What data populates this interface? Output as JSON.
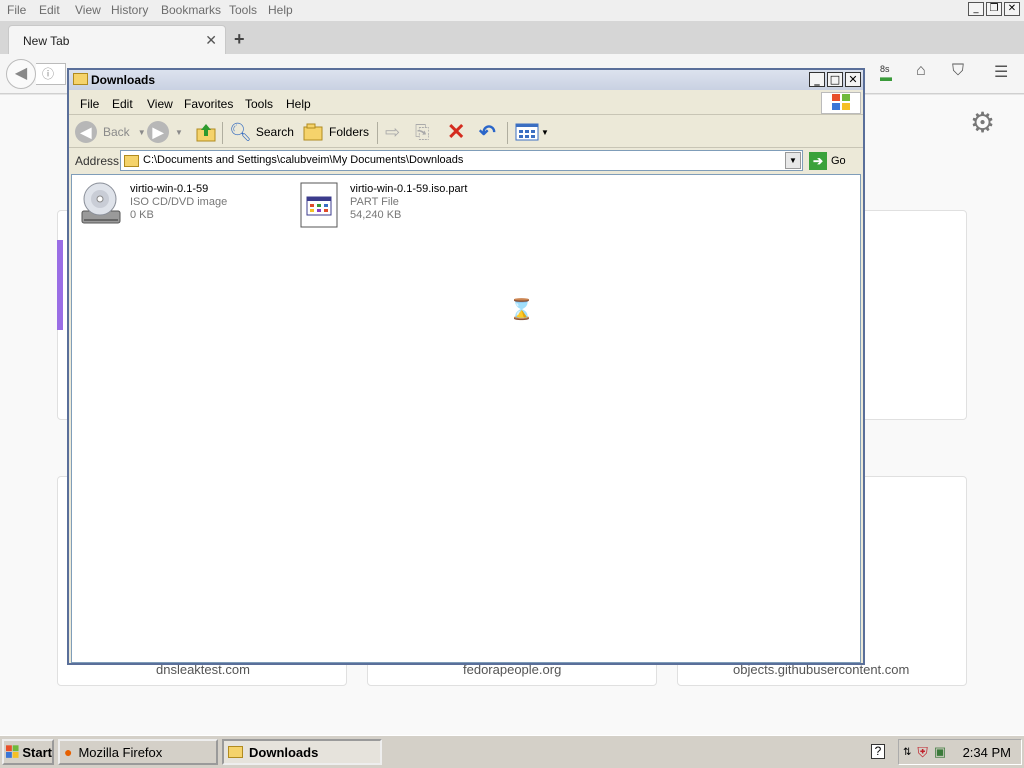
{
  "firefox": {
    "menu": [
      "File",
      "Edit",
      "View",
      "History",
      "Bookmarks",
      "Tools",
      "Help"
    ],
    "tab_title": "New Tab",
    "downloads_badge": "8s",
    "tiles": [
      {
        "label": "dnsleaktest.com"
      },
      {
        "label": "fedorapeople.org"
      },
      {
        "label": "objects.githubusercontent.com"
      }
    ]
  },
  "explorer": {
    "title": "Downloads",
    "menu": [
      "File",
      "Edit",
      "View",
      "Favorites",
      "Tools",
      "Help"
    ],
    "toolbar": {
      "back": "Back",
      "search": "Search",
      "folders": "Folders"
    },
    "address_label": "Address",
    "address_path": "C:\\Documents and Settings\\calubveim\\My Documents\\Downloads",
    "go_label": "Go",
    "files": [
      {
        "name": "virtio-win-0.1-59",
        "type": "ISO CD/DVD image",
        "size": "0 KB",
        "icon": "cd-drive-icon"
      },
      {
        "name": "virtio-win-0.1-59.iso.part",
        "type": "PART File",
        "size": "54,240 KB",
        "icon": "part-file-icon"
      }
    ]
  },
  "taskbar": {
    "start_label": "Start",
    "tasks": [
      {
        "label": "Mozilla Firefox",
        "active": false
      },
      {
        "label": "Downloads",
        "active": true
      }
    ],
    "clock": "2:34 PM"
  }
}
